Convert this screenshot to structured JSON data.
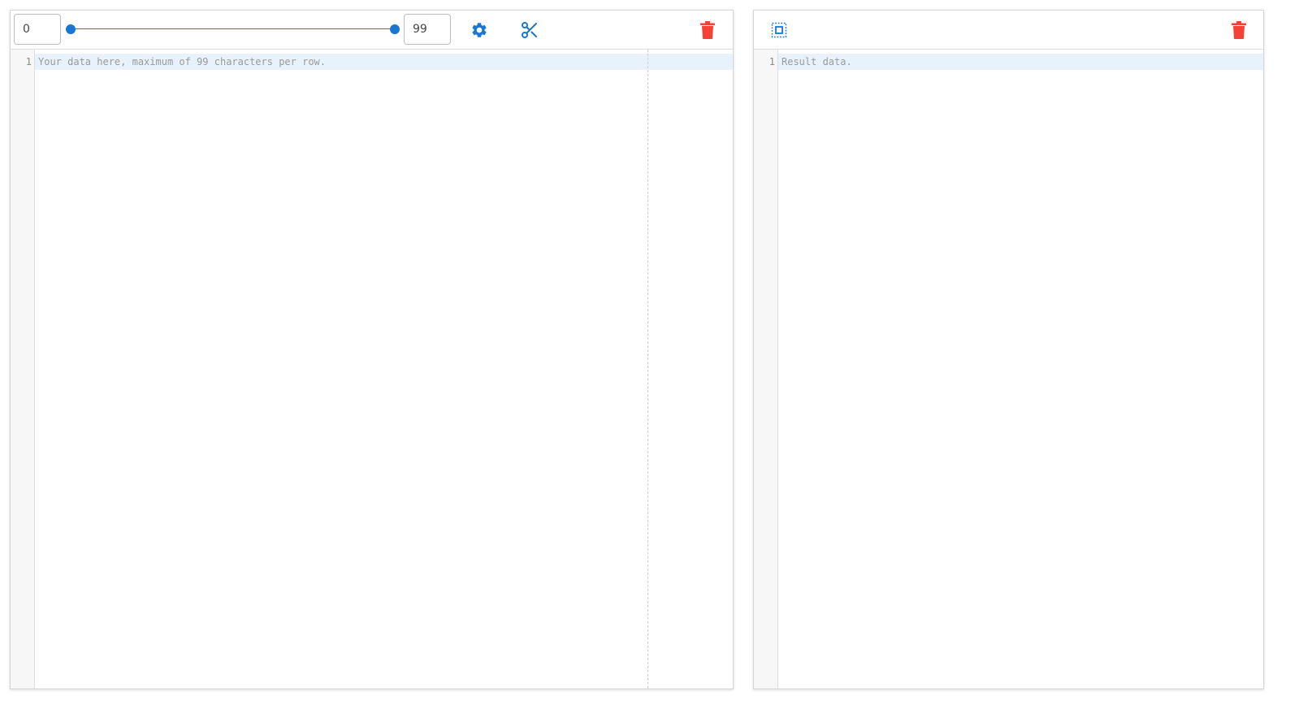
{
  "cutter": {
    "min_value": "0",
    "max_value": "99",
    "range_start": 0,
    "range_end": 99,
    "range_max": 99,
    "settings_icon": "gear-icon",
    "cut_icon": "scissors-icon",
    "clear_icon": "trash-icon"
  },
  "input_editor": {
    "line_number": "1",
    "placeholder": "Your data here, maximum of 99 characters per row."
  },
  "output_editor": {
    "line_number": "1",
    "placeholder": "Result data.",
    "select_icon": "select-all-icon",
    "clear_icon": "trash-icon"
  },
  "colors": {
    "accent": "#1976d2",
    "danger": "#f44336",
    "active_line": "#e8f2fc",
    "gutter": "#f7f7f7"
  }
}
